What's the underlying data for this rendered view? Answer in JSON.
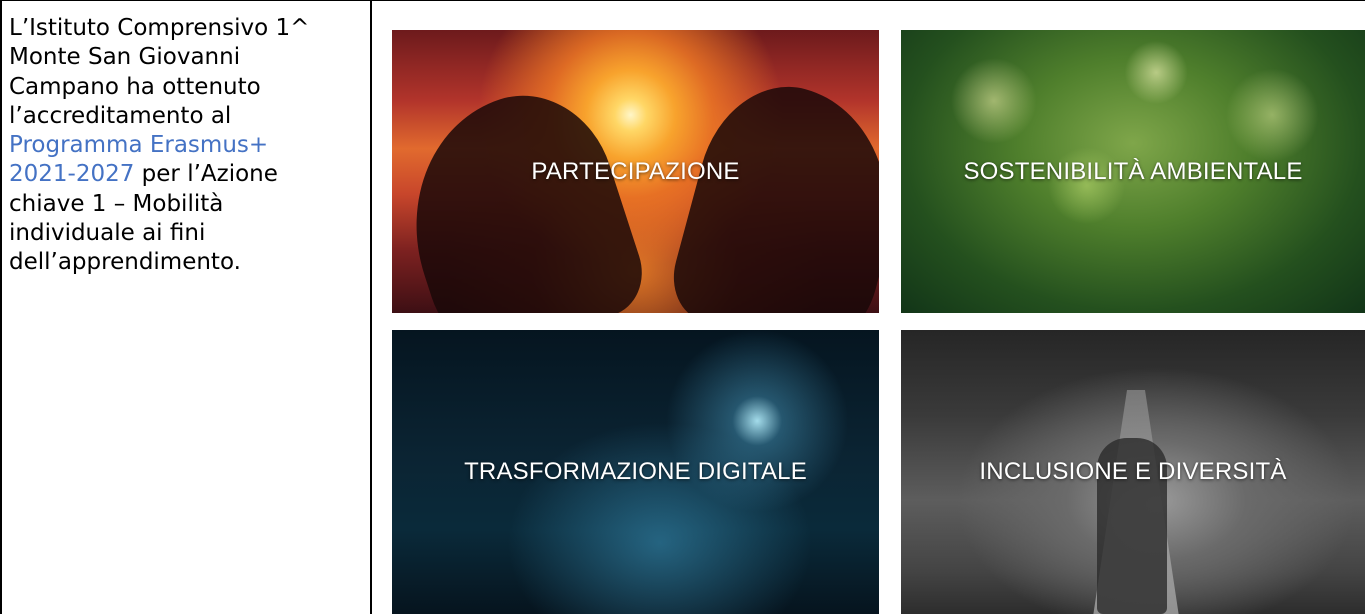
{
  "intro": {
    "lines": [
      {
        "text": "L’Istituto Comprensivo 1^"
      },
      {
        "text": "Monte San Giovanni"
      },
      {
        "text": "Campano ha ottenuto"
      },
      {
        "text": "l’accreditamento al"
      }
    ],
    "link_line1": "Programma Erasmus+",
    "link_line2": "2021-2027",
    "after_link": " per l’Azione",
    "rest_lines": [
      {
        "text": "chiave 1 – Mobilità"
      },
      {
        "text": "individuale ai fini"
      },
      {
        "text": "dell’apprendimento."
      }
    ],
    "link_color": "#4472c4"
  },
  "tiles": [
    {
      "label": "PARTECIPAZIONE"
    },
    {
      "label": "SOSTENIBILITÀ AMBIENTALE"
    },
    {
      "label": "TRASFORMAZIONE DIGITALE"
    },
    {
      "label": "INCLUSIONE E DIVERSITÀ"
    }
  ]
}
